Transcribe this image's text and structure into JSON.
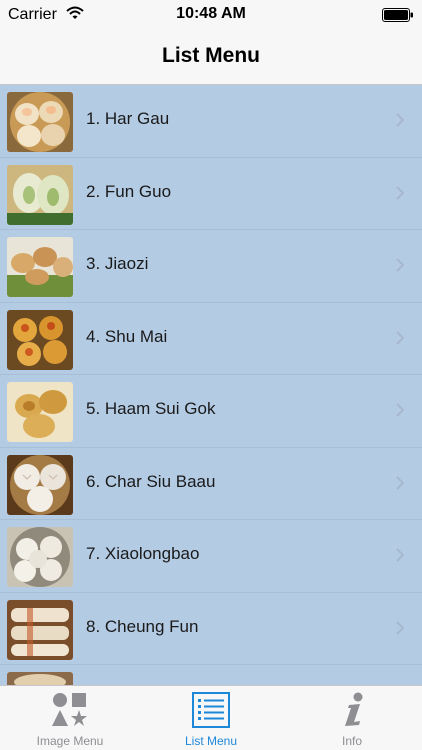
{
  "status_bar": {
    "carrier": "Carrier",
    "time": "10:48 AM"
  },
  "nav": {
    "title": "List Menu"
  },
  "list": {
    "items": [
      {
        "label": "1. Har Gau",
        "icon": "har-gau-photo"
      },
      {
        "label": "2. Fun Guo",
        "icon": "fun-guo-photo"
      },
      {
        "label": "3. Jiaozi",
        "icon": "jiaozi-photo"
      },
      {
        "label": "4. Shu Mai",
        "icon": "shu-mai-photo"
      },
      {
        "label": "5. Haam Sui Gok",
        "icon": "haam-sui-gok-photo"
      },
      {
        "label": "6. Char Siu Baau",
        "icon": "char-siu-baau-photo"
      },
      {
        "label": "7. Xiaolongbao",
        "icon": "xiaolongbao-photo"
      },
      {
        "label": "8. Cheung Fun",
        "icon": "cheung-fun-photo"
      }
    ]
  },
  "tab_bar": {
    "tabs": [
      {
        "label": "Image Menu",
        "icon": "shapes-icon"
      },
      {
        "label": "List Menu",
        "icon": "list-icon",
        "active": true
      },
      {
        "label": "Info",
        "icon": "info-icon"
      }
    ]
  },
  "colors": {
    "list_background": "#b4cbe4",
    "tab_active": "#1e88d8",
    "tab_inactive": "#8e8e93"
  }
}
